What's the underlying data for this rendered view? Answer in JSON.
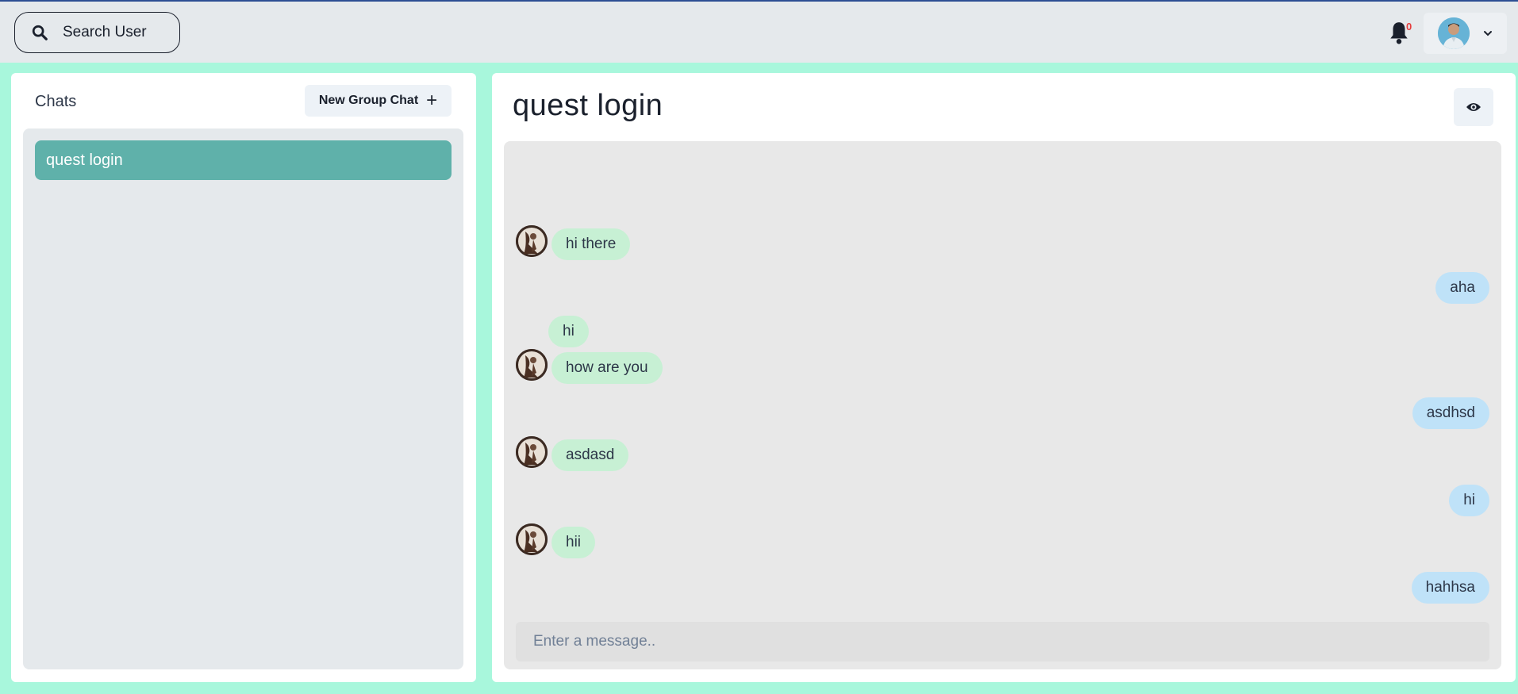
{
  "header": {
    "search_label": "Search User",
    "notification_count": "0"
  },
  "sidebar": {
    "title": "Chats",
    "new_group_label": "New Group Chat",
    "chats": [
      {
        "name": "quest login",
        "selected": true
      }
    ]
  },
  "chat": {
    "title": "quest login",
    "messages": [
      {
        "text": "hi there",
        "direction": "incoming",
        "show_avatar": true
      },
      {
        "text": "aha",
        "direction": "outgoing",
        "show_avatar": false
      },
      {
        "text": "hi",
        "direction": "incoming",
        "show_avatar": false
      },
      {
        "text": "how are you",
        "direction": "incoming",
        "show_avatar": true
      },
      {
        "text": "asdhsd",
        "direction": "outgoing",
        "show_avatar": false
      },
      {
        "text": "asdasd",
        "direction": "incoming",
        "show_avatar": true
      },
      {
        "text": "hi",
        "direction": "outgoing",
        "show_avatar": false
      },
      {
        "text": "hii",
        "direction": "incoming",
        "show_avatar": true
      },
      {
        "text": "hahhsa",
        "direction": "outgoing",
        "show_avatar": false
      }
    ],
    "input_placeholder": "Enter a message.."
  },
  "colors": {
    "page_background": "#a8f7dc",
    "selected_chat": "#5fb1aa",
    "incoming_bubble": "#c7f0d4",
    "outgoing_bubble": "#bfe2f8",
    "notification_badge": "#e53e3e"
  },
  "icons": {
    "search": "search-icon",
    "notifications": "bell-icon",
    "menu": "chevron-down-icon",
    "add": "plus-icon",
    "view_profile": "eye-icon"
  }
}
